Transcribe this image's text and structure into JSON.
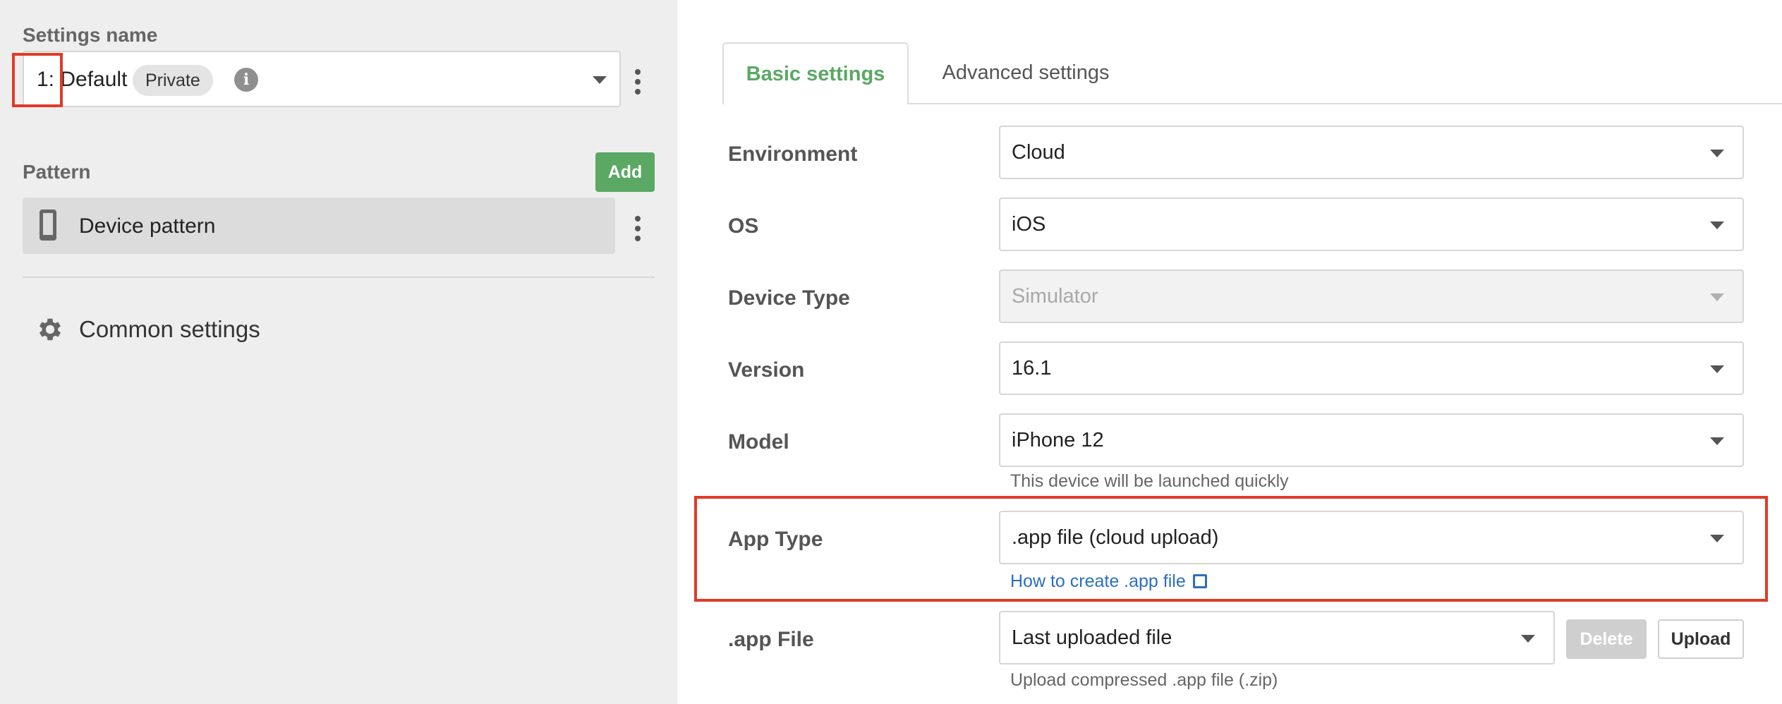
{
  "left": {
    "settings_name_label": "Settings name",
    "settings_name_value": "1: Default",
    "visibility_badge": "Private",
    "pattern_label": "Pattern",
    "add_button": "Add",
    "pattern_item": "Device pattern",
    "common_settings": "Common settings"
  },
  "tabs": {
    "basic": "Basic settings",
    "advanced": "Advanced settings"
  },
  "form": {
    "environment": {
      "label": "Environment",
      "value": "Cloud"
    },
    "os": {
      "label": "OS",
      "value": "iOS"
    },
    "device_type": {
      "label": "Device Type",
      "value": "Simulator"
    },
    "version": {
      "label": "Version",
      "value": "16.1"
    },
    "model": {
      "label": "Model",
      "value": "iPhone 12",
      "hint": "This device will be launched quickly"
    },
    "app_type": {
      "label": "App Type",
      "value": ".app file (cloud upload)",
      "link": "How to create .app file"
    },
    "app_file": {
      "label": ".app File",
      "value": "Last uploaded file",
      "delete_label": "Delete",
      "upload_label": "Upload",
      "hint": "Upload compressed .app file (.zip)"
    }
  },
  "colors": {
    "accent_green": "#5aa864",
    "highlight_red": "#e13a28",
    "link_blue": "#2a6fbf"
  },
  "icons": [
    "info-icon",
    "chevron-down-icon",
    "more-vertical-icon",
    "phone-icon",
    "gear-icon",
    "external-link-icon"
  ]
}
